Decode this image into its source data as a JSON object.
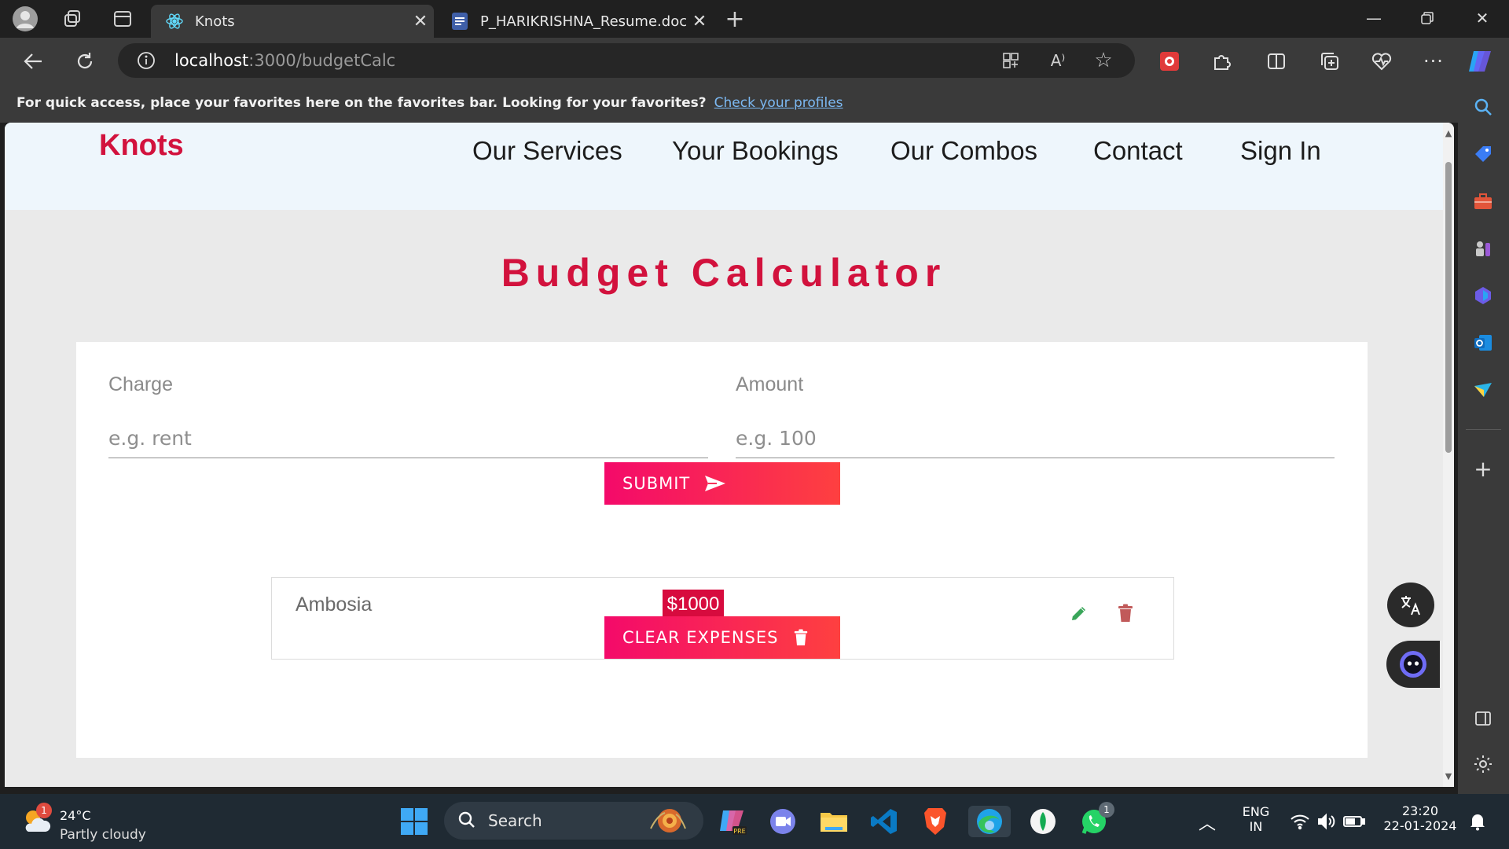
{
  "browser": {
    "tabs": [
      {
        "title": "Knots",
        "active": true
      },
      {
        "title": "P_HARIKRISHNA_Resume.docx - ",
        "active": false
      }
    ],
    "new_tab_symbol": "+",
    "url_host": "localhost",
    "url_path": ":3000/budgetCalc",
    "favorites_message": "For quick access, place your favorites here on the favorites bar. Looking for your favorites?",
    "favorites_link": "Check your profiles"
  },
  "site": {
    "brand": "Knots",
    "nav": [
      "Our Services",
      "Your Bookings",
      "Our Combos",
      "Contact",
      "Sign In"
    ],
    "accent_color": "#d2123d"
  },
  "calculator": {
    "title": "Budget Calculator",
    "charge_label": "Charge",
    "charge_placeholder": "e.g. rent",
    "amount_label": "Amount",
    "amount_placeholder": "e.g. 100",
    "submit_label": "SUBMIT",
    "clear_label": "CLEAR EXPENSES",
    "expenses": [
      {
        "name": "Ambosia",
        "amount": "$1000"
      }
    ]
  },
  "taskbar": {
    "weather_temp": "24°C",
    "weather_desc": "Partly cloudy",
    "weather_badge": "1",
    "search_label": "Search",
    "whatsapp_badge": "1",
    "lang_top": "ENG",
    "lang_bottom": "IN",
    "time": "23:20",
    "date": "22-01-2024"
  }
}
